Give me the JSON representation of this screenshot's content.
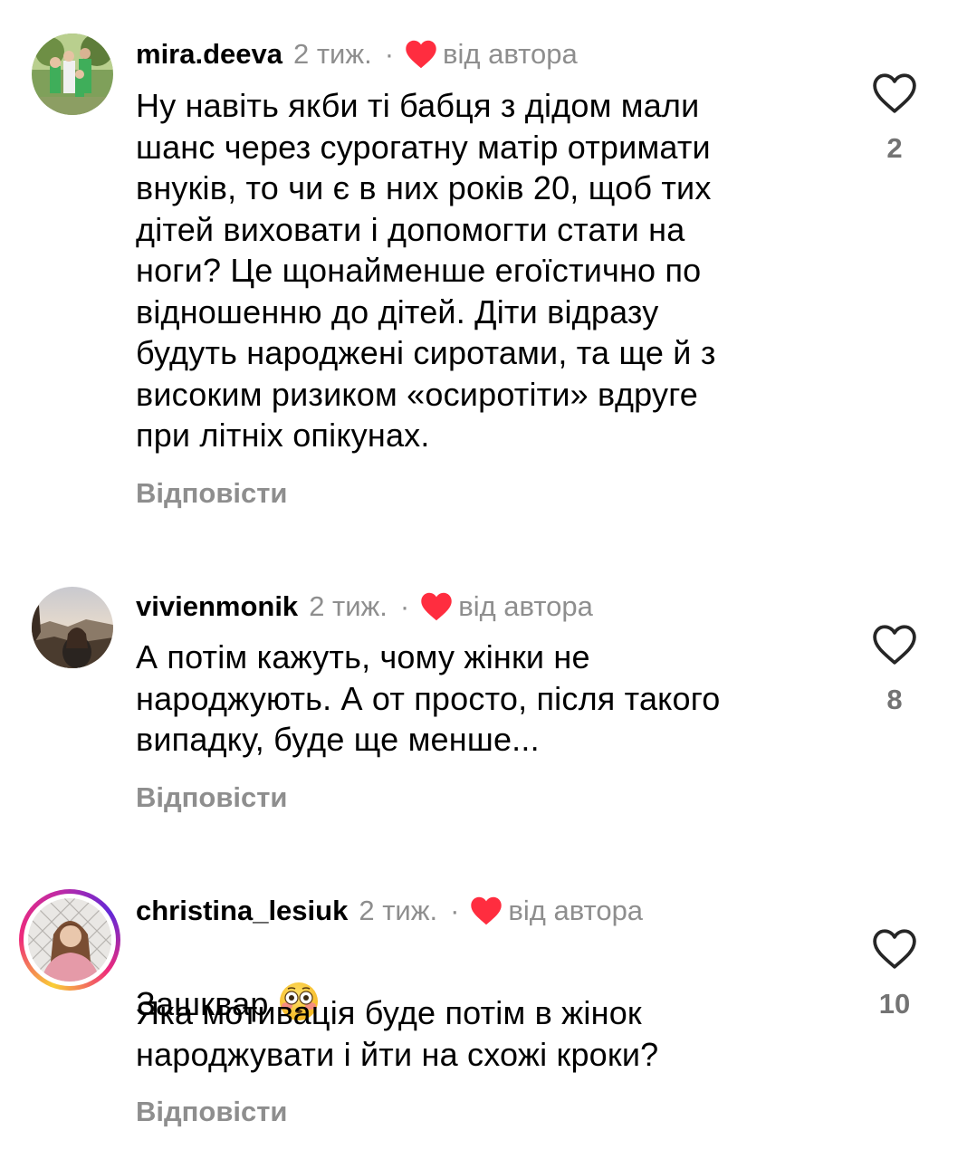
{
  "comments": [
    {
      "username": "mira.deeva",
      "time": "2 тиж.",
      "dot": "·",
      "author_label": "від автора",
      "text": "Ну навіть якби ті бабця з дідом мали\nшанс через сурогатну матір отримати\nвнуків, то чи є в них років 20, щоб тих\nдітей виховати і допомогти стати на\nноги? Це щонайменше егоїстично по\nвідношенню до дітей. Діти відразу\nбудуть народжені сиротами, та ще й з\nвисоким  ризиком «осиротіти» вдруге\nпри літніх опікунах.",
      "reply": "Відповісти",
      "likes": "2"
    },
    {
      "username": "vivienmonik",
      "time": "2 тиж.",
      "dot": "·",
      "author_label": "від автора",
      "text": "А потім кажуть, чому жінки не\nнароджують. А от просто, після такого\nвипадку, буде ще менше...",
      "reply": "Відповісти",
      "likes": "8"
    },
    {
      "username": "christina_lesiuk",
      "time": "2 тиж.",
      "dot": "·",
      "author_label": "від автора",
      "text_first": "Зашквар",
      "emoji": "flushed-face-emoji",
      "text": "Яка мотивація буде потім в жінок\nнароджувати і йти на схожі кроки?",
      "reply": "Відповісти",
      "likes": "10"
    }
  ],
  "colors": {
    "heart_red": "#ff2d3f",
    "muted": "#8e8e8e",
    "text": "#000000"
  }
}
